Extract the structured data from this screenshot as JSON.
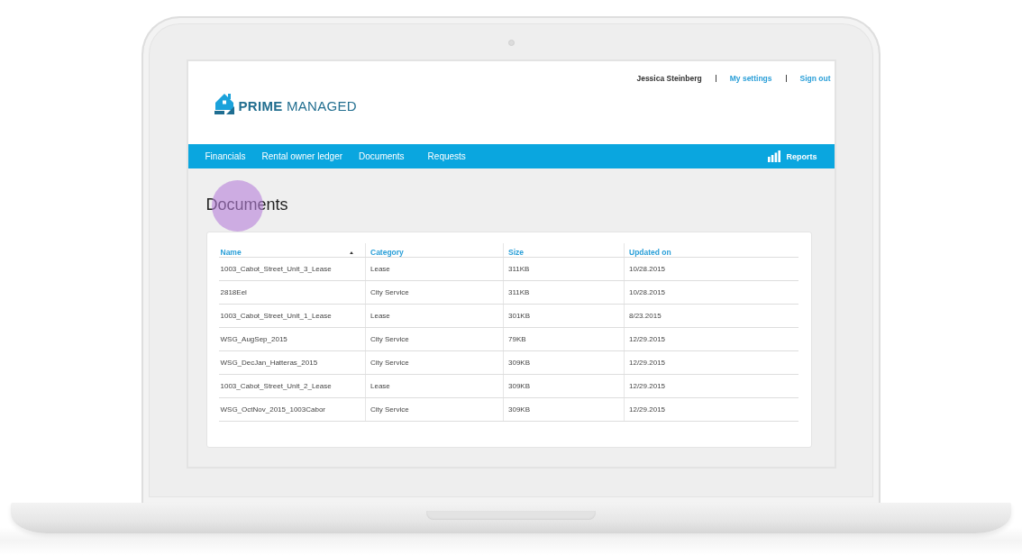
{
  "header": {
    "user": "Jessica Steinberg",
    "links": [
      "My settings",
      "Sign out"
    ]
  },
  "logo": {
    "text": "**PRIME** MANAGED"
  },
  "nav": {
    "items": [
      "Financials",
      "Rental owner ledger",
      "Documents",
      "Requests"
    ],
    "reports": "Reports"
  },
  "page": {
    "title": "Documents"
  },
  "table": {
    "columns": [
      {
        "label": "Name",
        "sorted": true
      },
      {
        "label": "Category",
        "sorted": false
      },
      {
        "label": "Size",
        "sorted": false
      },
      {
        "label": "Updated on",
        "sorted": false
      }
    ],
    "rows": [
      [
        "1003_Cabot_Street_Unit_3_Lease",
        "Lease",
        "311KB",
        "10/28.2015"
      ],
      [
        "2818Eel",
        "City Service",
        "311KB",
        "10/28.2015"
      ],
      [
        "1003_Cabot_Street_Unit_1_Lease",
        "Lease",
        "301KB",
        "8/23.2015"
      ],
      [
        "WSG_AugSep_2015",
        "City Service",
        "79KB",
        "12/29.2015"
      ],
      [
        "WSG_DecJan_Hatteras_2015",
        "City Service",
        "309KB",
        "12/29.2015"
      ],
      [
        "1003_Cabot_Street_Unit_2_Lease",
        "Lease",
        "309KB",
        "12/29.2015"
      ],
      [
        "WSG_OctNov_2015_1003Cabor",
        "City Service",
        "309KB",
        "12/29.2015"
      ]
    ]
  }
}
